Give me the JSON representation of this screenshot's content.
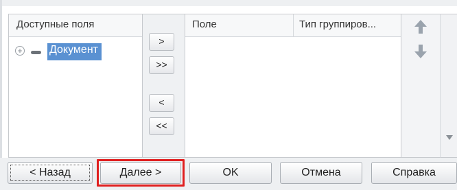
{
  "available_fields": {
    "header": "Доступные поля",
    "items": [
      {
        "label": "Документ",
        "selected": true
      }
    ]
  },
  "move_buttons": {
    "add": ">",
    "add_all": ">>",
    "remove": "<",
    "remove_all": "<<"
  },
  "grouping_table": {
    "columns": [
      "Поле",
      "Тип группиров..."
    ],
    "rows": []
  },
  "order_buttons": {
    "up_icon": "arrow-up-icon",
    "down_icon": "arrow-down-icon"
  },
  "footer": {
    "back": "< Назад",
    "next": "Далее >",
    "ok": "OK",
    "cancel": "Отмена",
    "help": "Справка"
  },
  "colors": {
    "selection": "#5a91d2",
    "highlight_frame": "#e01e1e",
    "arrow_icon": "#9aa3ad"
  }
}
